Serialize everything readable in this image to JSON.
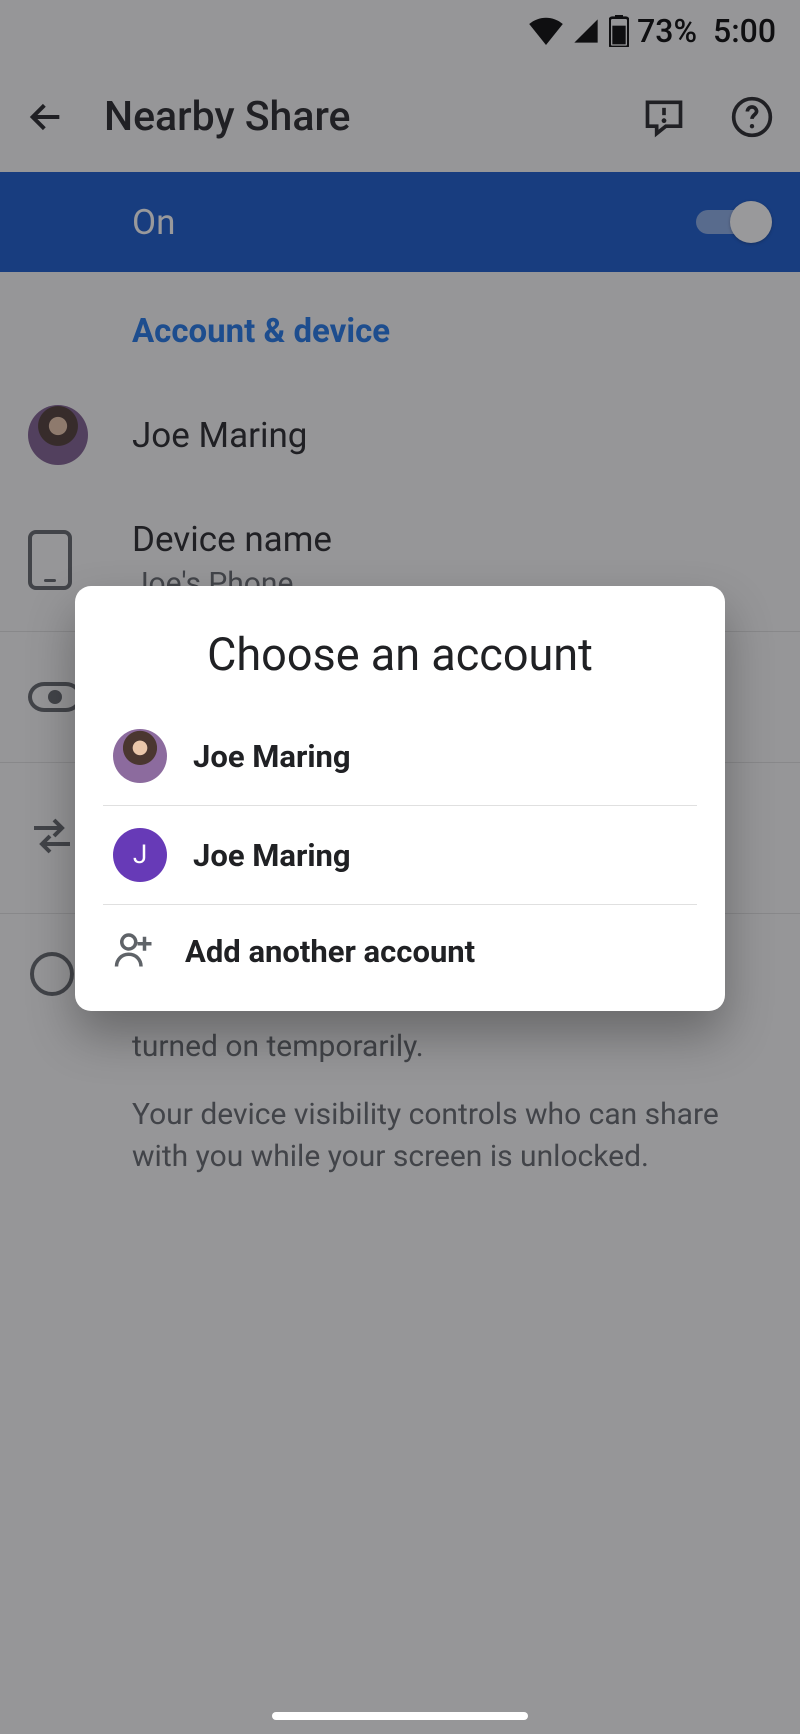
{
  "status": {
    "battery": "73%",
    "time": "5:00"
  },
  "appbar": {
    "title": "Nearby Share"
  },
  "switchRow": {
    "label": "On"
  },
  "section": {
    "header": "Account & device"
  },
  "account": {
    "name": "Joe Maring"
  },
  "device": {
    "title": "Device name",
    "value": "Joe's Phone"
  },
  "info": {
    "line1": "turned on temporarily.",
    "line2": "Your device visibility controls who can share with you while your screen is unlocked."
  },
  "dialog": {
    "title": "Choose an account",
    "accounts": [
      {
        "name": "Joe Maring",
        "initial": ""
      },
      {
        "name": "Joe Maring",
        "initial": "J"
      }
    ],
    "addLabel": "Add another account"
  }
}
